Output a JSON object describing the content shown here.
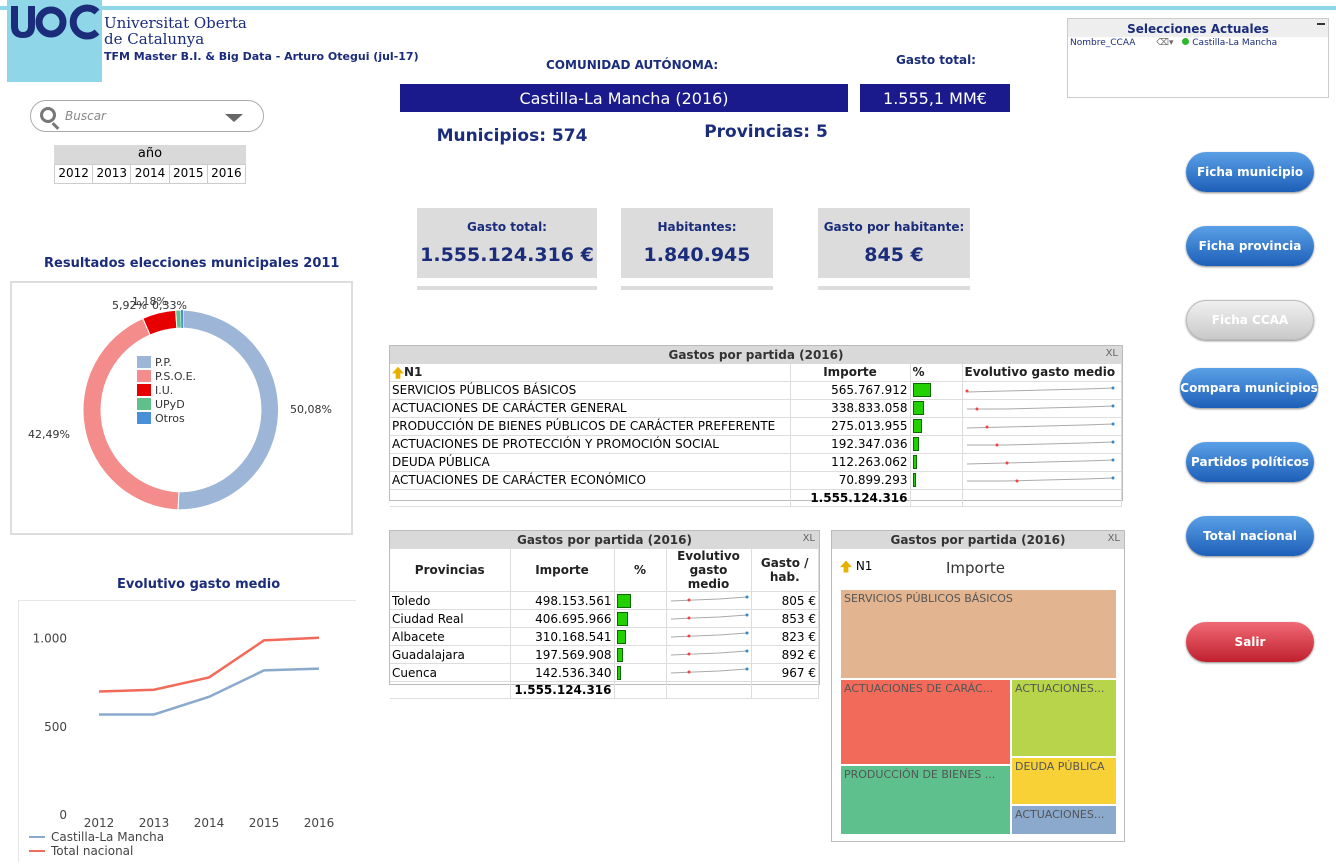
{
  "header": {
    "univ_line1": "Universitat Oberta",
    "univ_line2": "de Catalunya",
    "logo_text": "UOC",
    "tfm": "TFM Master B.I. & Big Data - Arturo Otegui (jul-17)",
    "comunidad_label": "COMUNIDAD AUTÓNOMA:",
    "gasto_total_label": "Gasto total:",
    "region": "Castilla-La Mancha (2016)",
    "gasto_total_value": "1.555,1 MM€",
    "municipios": "Municipios: 574",
    "provincias": "Provincias: 5"
  },
  "selecciones": {
    "title": "Selecciones Actuales",
    "field": "Nombre_CCAA",
    "value": "Castilla-La Mancha"
  },
  "search": {
    "placeholder": "Buscar"
  },
  "year": {
    "title": "año",
    "options": [
      "2012",
      "2013",
      "2014",
      "2015",
      "2016"
    ]
  },
  "kpis": [
    {
      "label": "Gasto total:",
      "value": "1.555.124.316 €"
    },
    {
      "label": "Habitantes:",
      "value": "1.840.945"
    },
    {
      "label": "Gasto por habitante:",
      "value": "845 €"
    }
  ],
  "buttons": {
    "ficha_municipio": "Ficha municipio",
    "ficha_provincia": "Ficha provincia",
    "ficha_ccaa": "Ficha CCAA",
    "compara_municipios": "Compara municipios",
    "partidos_politicos": "Partidos políticos",
    "total_nacional": "Total nacional",
    "salir": "Salir"
  },
  "election": {
    "title": "Resultados elecciones municipales 2011",
    "legend": [
      {
        "label": "P.P.",
        "color": "#9db5d6"
      },
      {
        "label": "P.S.O.E.",
        "color": "#f48c8c"
      },
      {
        "label": "I.U.",
        "color": "#e60000"
      },
      {
        "label": "UPyD",
        "color": "#60c08c"
      },
      {
        "label": "Otros",
        "color": "#4a90d9"
      }
    ],
    "labels": {
      "pp": "50,08%",
      "psoe": "42,49%",
      "iu": "5,92%",
      "upyd": "1,18%",
      "otros": "0,33%"
    }
  },
  "evolutivo": {
    "title": "Evolutivo gasto medio",
    "legend": [
      "Castilla-La Mancha",
      "Total nacional"
    ]
  },
  "table_partidas": {
    "title": "Gastos por partida (2016)",
    "xl": "XL",
    "headers": {
      "n1": "N1",
      "importe": "Importe",
      "pct": "%",
      "evol": "Evolutivo gasto medio"
    },
    "rows": [
      {
        "name": "SERVICIOS PÚBLICOS BÁSICOS",
        "importe": "565.767.912",
        "pct": 36.4
      },
      {
        "name": "ACTUACIONES DE CARÁCTER GENERAL",
        "importe": "338.833.058",
        "pct": 21.8
      },
      {
        "name": "PRODUCCIÓN DE BIENES PÚBLICOS DE CARÁCTER PREFERENTE",
        "importe": "275.013.955",
        "pct": 17.7
      },
      {
        "name": "ACTUACIONES DE PROTECCIÓN Y PROMOCIÓN SOCIAL",
        "importe": "192.347.036",
        "pct": 12.4
      },
      {
        "name": "DEUDA PÚBLICA",
        "importe": "112.263.062",
        "pct": 7.2
      },
      {
        "name": "ACTUACIONES DE CARÁCTER ECONÓMICO",
        "importe": "70.899.293",
        "pct": 4.6
      }
    ],
    "total": "1.555.124.316"
  },
  "table_provincias": {
    "title": "Gastos por partida (2016)",
    "xl": "XL",
    "headers": {
      "prov": "Provincias",
      "importe": "Importe",
      "pct": "%",
      "evol": "Evolutivo gasto medio",
      "gasto_hab": "Gasto / hab."
    },
    "rows": [
      {
        "name": "Toledo",
        "importe": "498.153.561",
        "pct": 32.0,
        "gh": "805 €"
      },
      {
        "name": "Ciudad Real",
        "importe": "406.695.966",
        "pct": 26.2,
        "gh": "853 €"
      },
      {
        "name": "Albacete",
        "importe": "310.168.541",
        "pct": 19.9,
        "gh": "823 €"
      },
      {
        "name": "Guadalajara",
        "importe": "197.569.908",
        "pct": 12.7,
        "gh": "892 €"
      },
      {
        "name": "Cuenca",
        "importe": "142.536.340",
        "pct": 9.2,
        "gh": "967 €"
      }
    ],
    "total": "1.555.124.316"
  },
  "treemap": {
    "title": "Gastos por partida (2016)",
    "xl": "XL",
    "n1": "N1",
    "importe": "Importe",
    "cells": [
      {
        "label": "SERVICIOS PÚBLICOS BÁSICOS",
        "color": "#e2b48f"
      },
      {
        "label": "ACTUACIONES DE CARÁC...",
        "color": "#f26a5a"
      },
      {
        "label": "ACTUACIONES...",
        "color": "#b8d44a"
      },
      {
        "label": "PRODUCCIÓN DE BIENES ...",
        "color": "#5ec08c"
      },
      {
        "label": "DEUDA PÚBLICA",
        "color": "#f7d136"
      },
      {
        "label": "ACTUACIONES...",
        "color": "#8aa9cc"
      }
    ]
  },
  "chart_data": {
    "type": "line",
    "title": "Evolutivo gasto medio",
    "x": [
      "2012",
      "2013",
      "2014",
      "2015",
      "2016"
    ],
    "series": [
      {
        "name": "Castilla-La Mancha",
        "values": [
          570,
          570,
          670,
          820,
          830
        ],
        "color": "#8aa9cc"
      },
      {
        "name": "Total nacional",
        "values": [
          700,
          710,
          780,
          990,
          1005
        ],
        "color": "#f26a5a"
      }
    ],
    "ylim": [
      0,
      1100
    ],
    "yticks": [
      "0",
      "500",
      "1.000"
    ],
    "grid": false,
    "legend_placement": "bottom-left"
  }
}
